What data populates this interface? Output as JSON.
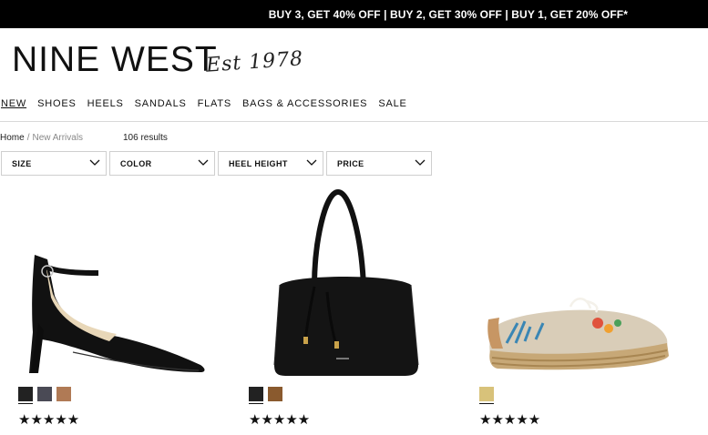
{
  "promo": {
    "text": "BUY 3, GET 40% OFF | BUY 2, GET 30% OFF | BUY 1, GET 20% OFF*"
  },
  "brand": {
    "logo": "NINE WEST",
    "tagline": "Est 1978"
  },
  "nav": [
    {
      "label": "NEW"
    },
    {
      "label": "SHOES"
    },
    {
      "label": "HEELS"
    },
    {
      "label": "SANDALS"
    },
    {
      "label": "FLATS"
    },
    {
      "label": "BAGS & ACCESSORIES"
    },
    {
      "label": "SALE"
    }
  ],
  "breadcrumb": {
    "home": "Home",
    "separator": "/",
    "current": "New Arrivals"
  },
  "results": {
    "count_text": "106 results"
  },
  "filters": [
    {
      "label": "SIZE"
    },
    {
      "label": "COLOR"
    },
    {
      "label": "HEEL HEIGHT"
    },
    {
      "label": "PRICE"
    }
  ],
  "products": [
    {
      "image": "black-ankle-strap-pump",
      "swatches": [
        "#222222",
        "#4a4a55",
        "#b07a55"
      ],
      "rating": "★★★★★"
    },
    {
      "image": "black-tote-bag",
      "swatches": [
        "#222222",
        "#8a5a2e"
      ],
      "rating": "★★★★★"
    },
    {
      "image": "floral-embroidered-espadrille",
      "swatches": [
        "#d8c27a"
      ],
      "rating": "★★★★★"
    }
  ]
}
